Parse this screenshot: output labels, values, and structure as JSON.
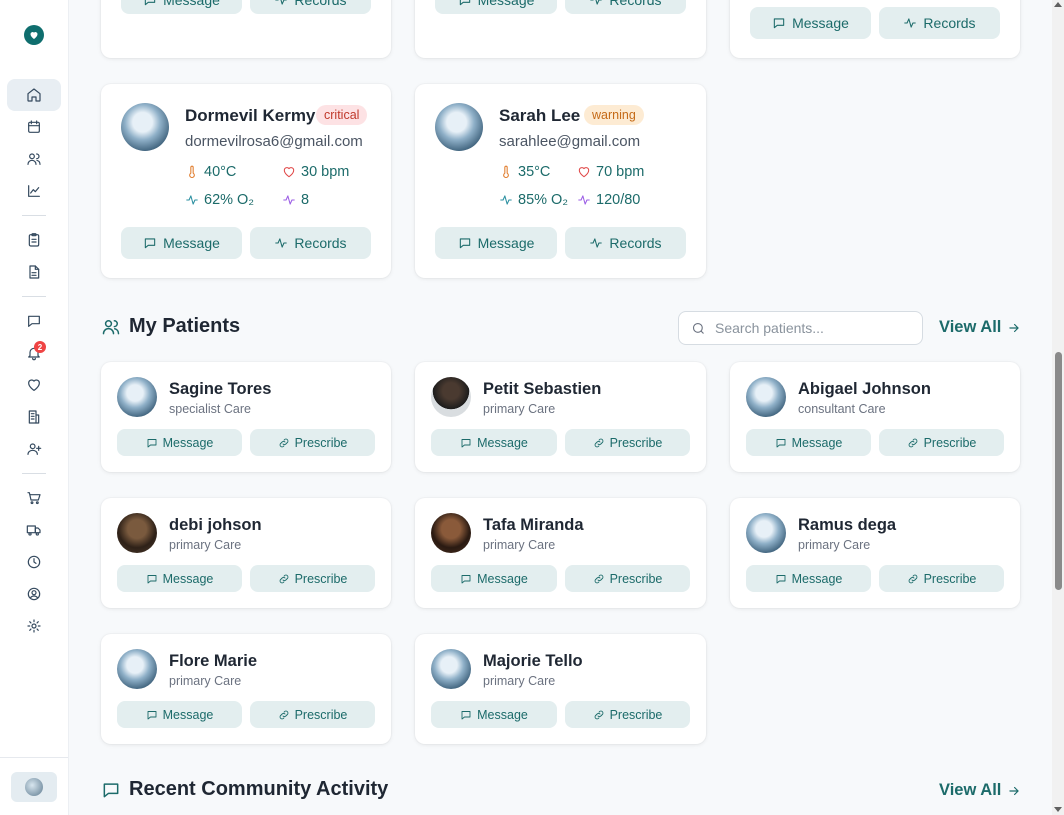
{
  "top_cards": {
    "message_label": "Message",
    "records_label": "Records"
  },
  "critical_patients": [
    {
      "name": "Dormevil Kermy",
      "status": "critical",
      "email": "dormevilrosa6@gmail.com",
      "temperature": "40°C",
      "heart_rate": "30 bpm",
      "oxygen": "62% O₂",
      "fourth_vital": "8",
      "message_label": "Message",
      "records_label": "Records"
    },
    {
      "name": "Sarah Lee",
      "status": "warning",
      "email": "sarahlee@gmail.com",
      "temperature": "35°C",
      "heart_rate": "70 bpm",
      "oxygen": "85% O₂",
      "fourth_vital": "120/80",
      "message_label": "Message",
      "records_label": "Records"
    }
  ],
  "my_patients": {
    "title": "My Patients",
    "search_placeholder": "Search patients...",
    "view_all": "View All",
    "message_label": "Message",
    "prescribe_label": "Prescribe",
    "patients": [
      {
        "name": "Sagine Tores",
        "care": "specialist Care"
      },
      {
        "name": "Petit Sebastien",
        "care": "primary Care"
      },
      {
        "name": "Abigael Johnson",
        "care": "consultant Care"
      },
      {
        "name": "debi johson",
        "care": "primary Care"
      },
      {
        "name": "Tafa Miranda",
        "care": "primary Care"
      },
      {
        "name": "Ramus dega",
        "care": "primary Care"
      },
      {
        "name": "Flore Marie",
        "care": "primary Care"
      },
      {
        "name": "Majorie Tello",
        "care": "primary Care"
      }
    ]
  },
  "community": {
    "title": "Recent Community Activity",
    "view_all": "View All"
  },
  "sidebar": {
    "notification_count": "2",
    "icons": [
      "home-icon",
      "calendar-icon",
      "users-icon",
      "chart-icon",
      "clipboard-icon",
      "file-text-icon",
      "message-icon",
      "bell-icon",
      "heart-icon",
      "building-icon",
      "user-plus-icon",
      "cart-icon",
      "truck-icon",
      "clock-icon",
      "user-circle-icon",
      "settings-icon"
    ]
  },
  "colors": {
    "accent": "#1c6b6a",
    "button_bg": "#e3eeef",
    "critical": "#c0392b",
    "warning": "#c56a17"
  }
}
